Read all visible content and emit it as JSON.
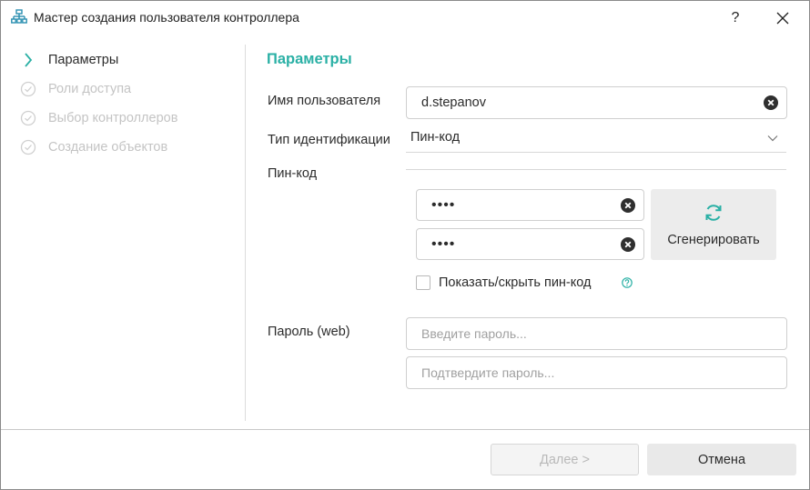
{
  "window": {
    "title": "Мастер создания пользователя контроллера",
    "help_label": "?",
    "close_label": "✕"
  },
  "nav": {
    "steps": [
      {
        "label": "Параметры",
        "state": "active"
      },
      {
        "label": "Роли доступа",
        "state": "pending"
      },
      {
        "label": "Выбор контроллеров",
        "state": "pending"
      },
      {
        "label": "Создание объектов",
        "state": "pending"
      }
    ]
  },
  "form": {
    "section_title": "Параметры",
    "username_label": "Имя пользователя",
    "username_value": "d.stepanov",
    "id_type_label": "Тип идентификации",
    "id_type_value": "Пин-код",
    "pin_label": "Пин-код",
    "pin_value": "••••",
    "pin_confirm_value": "••••",
    "generate_label": "Сгенерировать",
    "show_pin_label": "Показать/скрыть пин-код",
    "show_pin_checked": false,
    "password_label": "Пароль (web)",
    "password_placeholder": "Введите пароль...",
    "password_confirm_placeholder": "Подтвердите пароль..."
  },
  "footer": {
    "next_label": "Далее >",
    "next_enabled": false,
    "cancel_label": "Отмена"
  },
  "colors": {
    "accent": "#2ab0a5",
    "disabled_text": "#c4c4c4",
    "app_icon": "#2a8fb0"
  },
  "icons": {
    "app": "network-tree-icon",
    "active_step": "chevron-right-icon",
    "pending_step": "check-circle-icon",
    "clear": "clear-circle-icon",
    "generate": "refresh-icon",
    "dropdown": "chevron-down-icon",
    "help": "question-circle-icon"
  }
}
